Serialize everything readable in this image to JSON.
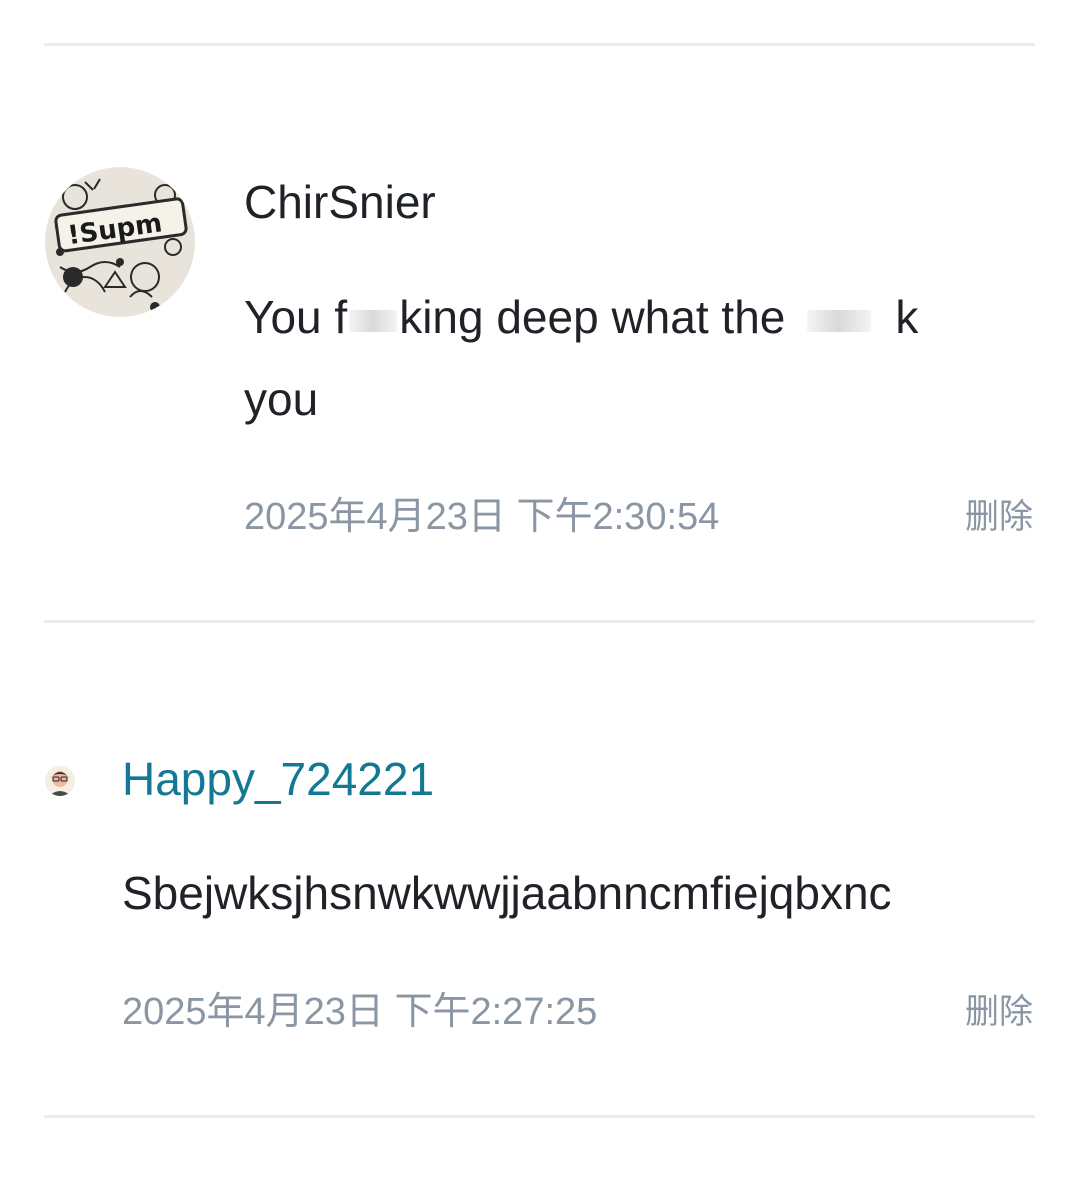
{
  "comments": [
    {
      "username": "ChirSnier",
      "text_line1_a": "You f",
      "text_line1_b": "king deep what the",
      "text_line1_c": "k",
      "text_line2": "you",
      "timestamp": "2025年4月23日 下午2:30:54",
      "delete_label": "删除",
      "avatar_icon": "doodle-sticker-avatar",
      "avatar_text": "!Supm"
    },
    {
      "username": "Happy_724221",
      "text": "Sbejwksjhsnwkwwjjaabnncmfiejqbxnc",
      "timestamp": "2025年4月23日 下午2:27:25",
      "delete_label": "删除",
      "avatar_icon": "person-avatar"
    }
  ],
  "colors": {
    "username_link": "#137893",
    "meta_text": "#8a96a3",
    "divider": "#e9ebf0"
  }
}
